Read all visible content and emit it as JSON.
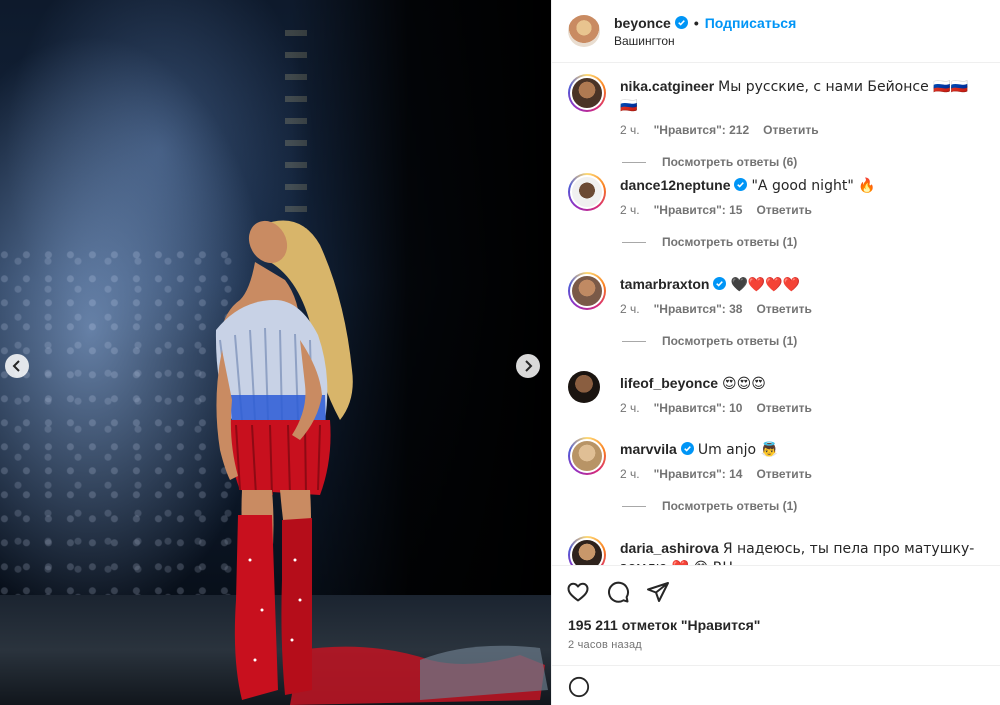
{
  "header": {
    "username": "beyonce",
    "dot": "•",
    "follow_label": "Подписаться",
    "location": "Вашингтон"
  },
  "comments": [
    {
      "username": "nika.catgineer",
      "text": "Мы русские, с нами Бейонсе 🇷🇺🇷🇺🇷🇺",
      "time": "2 ч.",
      "likes": "\"Нравится\": 212",
      "reply_label": "Ответить",
      "view_replies": "Посмотреть ответы (6)",
      "verified": false,
      "avatar_color": "#8a5a3c"
    },
    {
      "username": "dance12neptune",
      "text": "\"A good night\" 🔥",
      "time": "2 ч.",
      "likes": "\"Нравится\": 15",
      "reply_label": "Ответить",
      "view_replies": "Посмотреть ответы (1)",
      "verified": true,
      "avatar_color": "#5c4330"
    },
    {
      "username": "tamarbraxton",
      "text": "🖤❤️❤️❤️",
      "time": "2 ч.",
      "likes": "\"Нравится\": 38",
      "reply_label": "Ответить",
      "view_replies": "Посмотреть ответы (1)",
      "verified": true,
      "avatar_color": "#b77f5c"
    },
    {
      "username": "lifeof_beyonce",
      "text": "😍😍😍",
      "time": "2 ч.",
      "likes": "\"Нравится\": 10",
      "reply_label": "Ответить",
      "view_replies": "",
      "verified": false,
      "avatar_color": "#2a1f18"
    },
    {
      "username": "marvvila",
      "text": "Um anjo 👼",
      "time": "2 ч.",
      "likes": "\"Нравится\": 14",
      "reply_label": "Ответить",
      "view_replies": "Посмотреть ответы (1)",
      "verified": true,
      "avatar_color": "#d6b48a"
    },
    {
      "username": "daria_ashirova",
      "text": "Я надеюсь, ты пела про матушку-землю ❤️ 😊 RU",
      "time": "",
      "likes": "",
      "reply_label": "",
      "view_replies": "",
      "verified": false,
      "avatar_color": "#3a2a22"
    }
  ],
  "footer": {
    "likes_total": "195 211 отметок \"Нравится\"",
    "time_ago": "2 часов назад"
  },
  "colors": {
    "accent": "#0095f6",
    "verified": "#0095f6"
  },
  "icons": [
    "heart-icon",
    "comment-icon",
    "share-icon",
    "emoji-icon",
    "verified-badge-icon",
    "chevron-left-icon",
    "chevron-right-icon"
  ]
}
